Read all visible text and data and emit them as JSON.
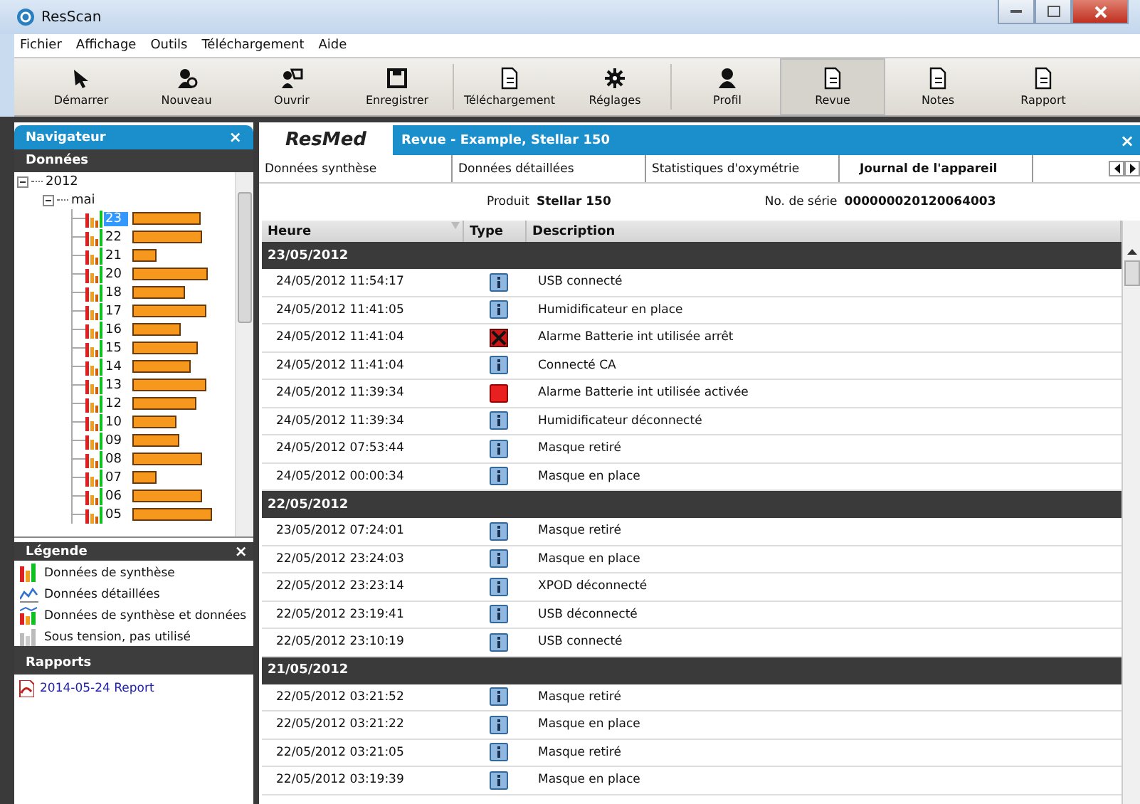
{
  "window": {
    "title": "ResScan"
  },
  "menu": [
    "Fichier",
    "Affichage",
    "Outils",
    "Téléchargement",
    "Aide"
  ],
  "toolbar": [
    {
      "label": "Démarrer",
      "selected": false
    },
    {
      "label": "Nouveau",
      "selected": false
    },
    {
      "label": "Ouvrir",
      "selected": false
    },
    {
      "label": "Enregistrer",
      "selected": false
    },
    {
      "label": "Téléchargement",
      "selected": false
    },
    {
      "label": "Réglages",
      "selected": false
    },
    {
      "label": "Profil",
      "selected": false
    },
    {
      "label": "Revue",
      "selected": true
    },
    {
      "label": "Notes",
      "selected": false
    },
    {
      "label": "Rapport",
      "selected": false
    }
  ],
  "navigator": {
    "title": "Navigateur",
    "close": "×",
    "data_header": "Données",
    "tree": [
      {
        "label": "2012",
        "expanded": true,
        "children": [
          {
            "label": "mai",
            "expanded": true,
            "children": [
              {
                "label": "23",
                "selected": true
              },
              {
                "label": "22",
                "selected": false
              },
              {
                "label": "21",
                "selected": false
              },
              {
                "label": "20",
                "selected": false
              },
              {
                "label": "18",
                "selected": false
              },
              {
                "label": "17",
                "selected": false
              },
              {
                "label": "16",
                "selected": false
              },
              {
                "label": "15",
                "selected": false
              },
              {
                "label": "14",
                "selected": false
              },
              {
                "label": "13",
                "selected": false
              },
              {
                "label": "12",
                "selected": false
              },
              {
                "label": "10",
                "selected": false
              },
              {
                "label": "09",
                "selected": false
              },
              {
                "label": "08",
                "selected": false
              },
              {
                "label": "07",
                "selected": false
              },
              {
                "label": "06",
                "selected": false
              },
              {
                "label": "05",
                "selected": false
              }
            ]
          }
        ]
      }
    ]
  },
  "legend": {
    "title": "Légende",
    "close": "×",
    "items": [
      {
        "label": "Données de synthèse",
        "kind": "summary"
      },
      {
        "label": "Données détaillées",
        "kind": "detailed"
      },
      {
        "label": "Données de synthèse et données",
        "kind": "both"
      },
      {
        "label": "Sous tension, pas utilisé",
        "kind": "unused"
      }
    ]
  },
  "reports": {
    "title": "Rapports",
    "items": [
      "2014-05-24 Report"
    ]
  },
  "review": {
    "logo": "ResMed",
    "title": "Revue - Example, Stellar 150",
    "close": "×",
    "tabs": [
      {
        "label": "Données synthèse",
        "selected": false
      },
      {
        "label": "Données détaillées",
        "selected": false
      },
      {
        "label": "Statistiques d'oxymétrie",
        "selected": false
      },
      {
        "label": "Journal de l'appareil",
        "selected": true
      }
    ],
    "product_label": "Produit",
    "product": "Stellar 150",
    "serial_label": "No. de série",
    "serial": "000000020120064003",
    "columns": [
      "Heure",
      "Type",
      "Description"
    ],
    "groups": [
      {
        "date": "23/05/2012",
        "rows": [
          {
            "time": "24/05/2012 11:54:17",
            "kind": "info",
            "description": "USB connecté"
          },
          {
            "time": "24/05/2012 11:41:05",
            "kind": "info",
            "description": "Humidificateur en place"
          },
          {
            "time": "24/05/2012 11:41:04",
            "kind": "alarm-off",
            "description": "Alarme Batterie int utilisée arrêt"
          },
          {
            "time": "24/05/2012 11:41:04",
            "kind": "info",
            "description": "Connecté CA"
          },
          {
            "time": "24/05/2012 11:39:34",
            "kind": "alarm-on",
            "description": "Alarme Batterie int utilisée activée"
          },
          {
            "time": "24/05/2012 11:39:34",
            "kind": "info",
            "description": "Humidificateur déconnecté"
          },
          {
            "time": "24/05/2012 07:53:44",
            "kind": "info",
            "description": "Masque retiré"
          },
          {
            "time": "24/05/2012 00:00:34",
            "kind": "info",
            "description": "Masque en place"
          }
        ]
      },
      {
        "date": "22/05/2012",
        "rows": [
          {
            "time": "23/05/2012 07:24:01",
            "kind": "info",
            "description": "Masque retiré"
          },
          {
            "time": "22/05/2012 23:24:03",
            "kind": "info",
            "description": "Masque en place"
          },
          {
            "time": "22/05/2012 23:23:14",
            "kind": "info",
            "description": "XPOD déconnecté"
          },
          {
            "time": "22/05/2012 23:19:41",
            "kind": "info",
            "description": "USB déconnecté"
          },
          {
            "time": "22/05/2012 23:10:19",
            "kind": "info",
            "description": "USB connecté"
          }
        ]
      },
      {
        "date": "21/05/2012",
        "rows": [
          {
            "time": "22/05/2012 03:21:52",
            "kind": "info",
            "description": "Masque retiré"
          },
          {
            "time": "22/05/2012 03:21:22",
            "kind": "info",
            "description": "Masque en place"
          },
          {
            "time": "22/05/2012 03:21:05",
            "kind": "info",
            "description": "Masque retiré"
          },
          {
            "time": "22/05/2012 03:19:39",
            "kind": "info",
            "description": "Masque en place"
          }
        ]
      }
    ]
  }
}
